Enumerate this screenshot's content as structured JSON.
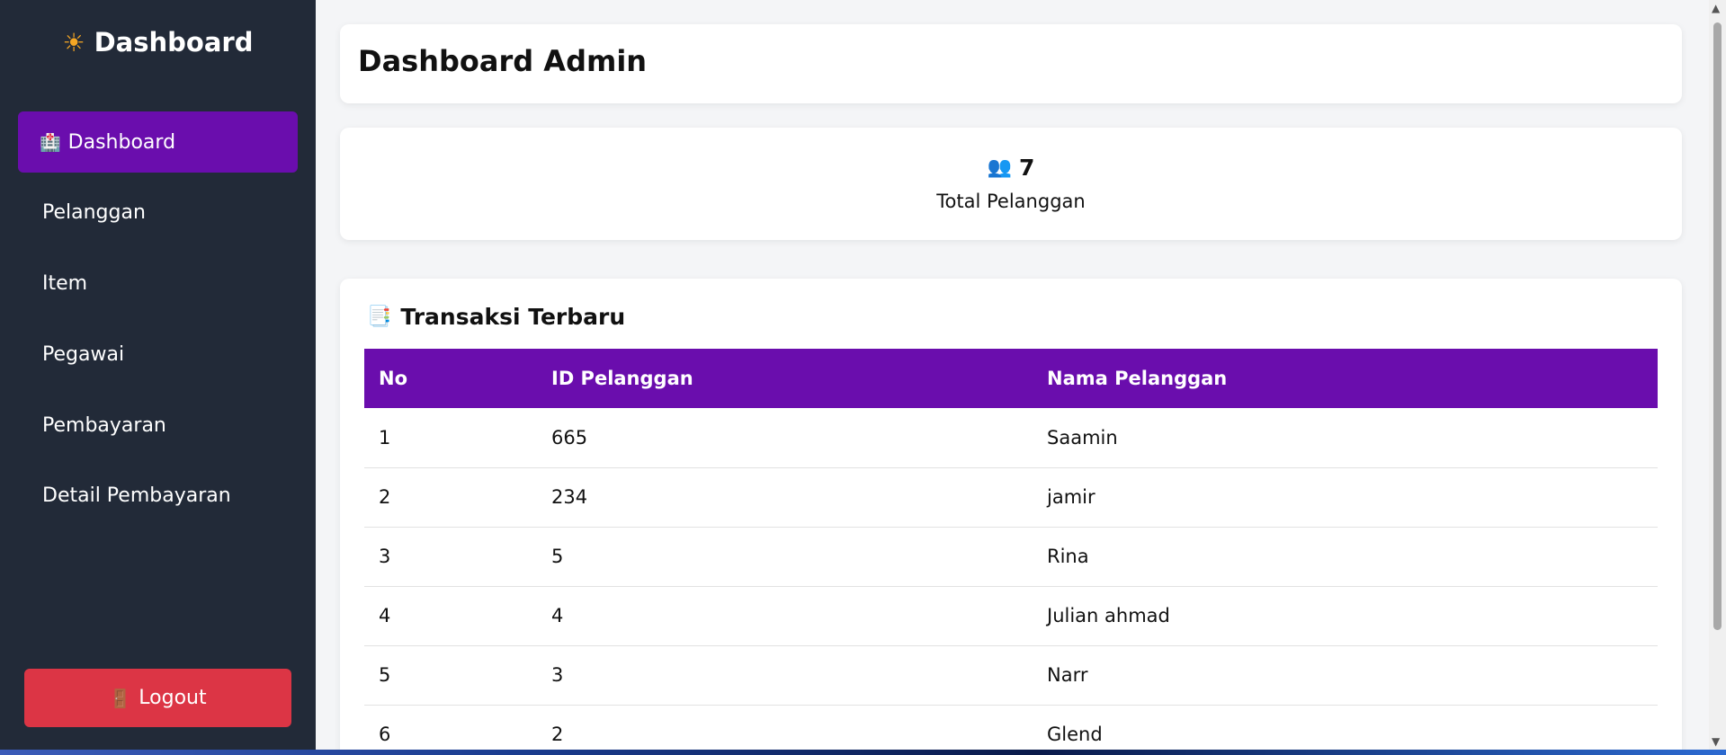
{
  "sidebar": {
    "brand_icon": "sun-icon",
    "brand_title": "Dashboard",
    "items": [
      {
        "label": "Dashboard",
        "icon": "hospital-icon",
        "active": true
      },
      {
        "label": "Pelanggan"
      },
      {
        "label": "Item"
      },
      {
        "label": "Pegawai"
      },
      {
        "label": "Pembayaran"
      },
      {
        "label": "Detail Pembayaran"
      }
    ],
    "logout_label": "Logout",
    "logout_icon": "door-icon"
  },
  "main": {
    "title": "Dashboard Admin",
    "stat": {
      "icon": "users-icon",
      "value": "7",
      "label": "Total Pelanggan"
    },
    "transactions": {
      "title": "Transaksi Terbaru",
      "icon": "memo-icon",
      "columns": [
        "No",
        "ID Pelanggan",
        "Nama Pelanggan"
      ],
      "rows": [
        [
          "1",
          "665",
          "Saamin"
        ],
        [
          "2",
          "234",
          "jamir"
        ],
        [
          "3",
          "5",
          "Rina"
        ],
        [
          "4",
          "4",
          "Julian ahmad"
        ],
        [
          "5",
          "3",
          "Narr"
        ],
        [
          "6",
          "2",
          "Glend"
        ]
      ]
    }
  },
  "colors": {
    "sidebar_bg": "#222a38",
    "accent": "#6a0dad",
    "logout": "#dc3545",
    "page_bg": "#f4f5f7"
  }
}
